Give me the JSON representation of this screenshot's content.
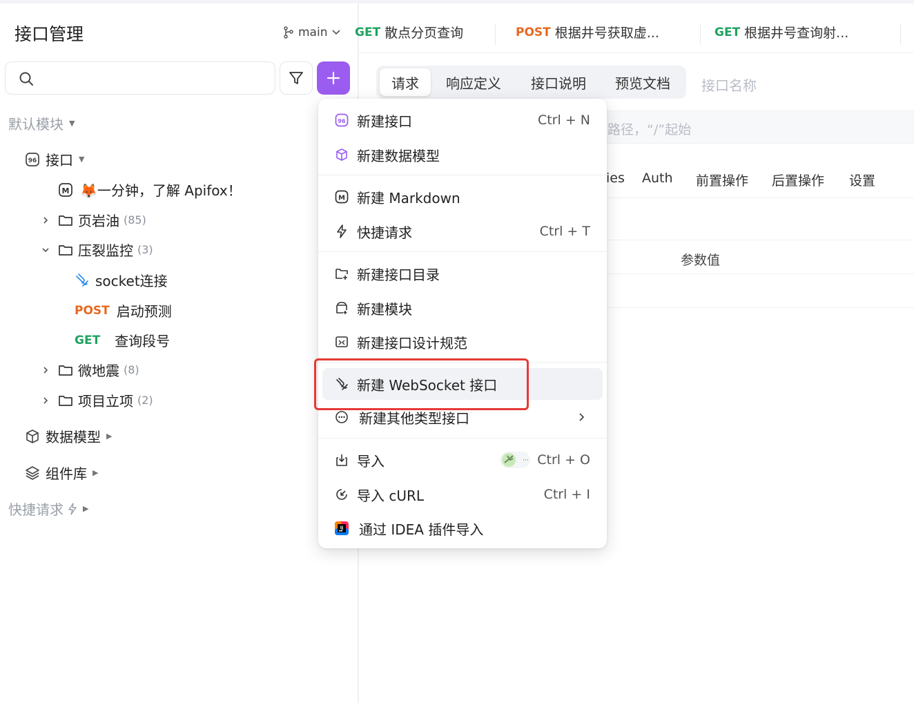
{
  "sidebar": {
    "title": "接口管理",
    "branch": "main",
    "default_module": "默认模块",
    "api_root": "接口",
    "tree": [
      {
        "label": "🦊一分钟，了解 Apifox！"
      },
      {
        "label": "页岩油",
        "count": "(85)"
      },
      {
        "label": "压裂监控",
        "count": "(3)"
      },
      {
        "label": "socket连接"
      },
      {
        "method": "POST",
        "label": "启动预测"
      },
      {
        "method": "GET",
        "label": "查询段号"
      },
      {
        "label": "微地震",
        "count": "(8)"
      },
      {
        "label": "项目立项",
        "count": "(2)"
      }
    ],
    "data_models": "数据模型",
    "components": "组件库",
    "quick_requests": "快捷请求"
  },
  "tabs": [
    {
      "method": "GET",
      "label": "散点分页查询"
    },
    {
      "method": "POST",
      "label": "根据井号获取虚..."
    },
    {
      "method": "GET",
      "label": "根据井号查询射..."
    }
  ],
  "segment": [
    "请求",
    "响应定义",
    "接口说明",
    "预览文档"
  ],
  "name_placeholder": "接口名称",
  "url_placeholder": "路径，“/”起始",
  "subtabs": [
    "ies",
    "Auth",
    "前置操作",
    "后置操作",
    "设置"
  ],
  "param_header": "参数值",
  "menu": {
    "items": [
      {
        "label": "新建接口",
        "shortcut": "Ctrl + N"
      },
      {
        "label": "新建数据模型",
        "shortcut": ""
      },
      {
        "label": "新建 Markdown",
        "shortcut": ""
      },
      {
        "label": "快捷请求",
        "shortcut": "Ctrl + T"
      },
      {
        "label": "新建接口目录",
        "shortcut": ""
      },
      {
        "label": "新建模块",
        "shortcut": ""
      },
      {
        "label": "新建接口设计规范",
        "shortcut": ""
      },
      {
        "label": "新建 WebSocket 接口",
        "shortcut": ""
      },
      {
        "label": "新建其他类型接口",
        "shortcut": ""
      },
      {
        "label": "导入",
        "shortcut": "Ctrl + O"
      },
      {
        "label": "导入 cURL",
        "shortcut": "Ctrl + I"
      },
      {
        "label": "通过 IDEA 插件导入",
        "shortcut": ""
      }
    ]
  },
  "colors": {
    "accent": "#9b5cf0",
    "post": "#e8681f",
    "get": "#1fa25f",
    "highlight_box": "#e53935"
  }
}
